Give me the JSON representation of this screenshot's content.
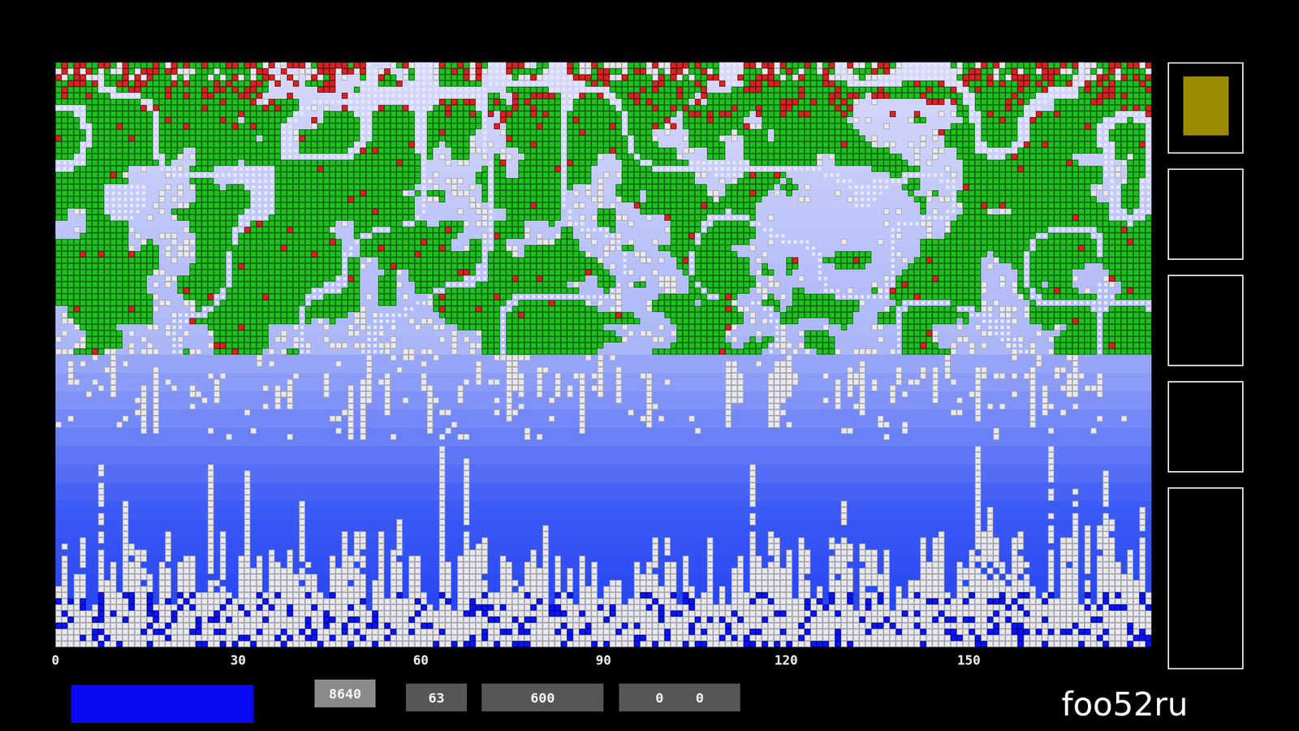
{
  "world": {
    "x_axis": {
      "ticks": [
        "0",
        "30",
        "60",
        "90",
        "120",
        "150"
      ]
    }
  },
  "side_panels": [
    {
      "filled": true,
      "color": "#9c8a00"
    },
    {
      "filled": false,
      "color": "#000000"
    },
    {
      "filled": false,
      "color": "#000000"
    },
    {
      "filled": false,
      "color": "#000000"
    },
    {
      "filled": false,
      "color": "#000000"
    }
  ],
  "status_bar": {
    "mode_indicator": {
      "color": "#0a0af2"
    },
    "counters": [
      {
        "values": [
          "8640"
        ],
        "highlighted": true
      },
      {
        "values": [
          "63"
        ],
        "highlighted": false
      },
      {
        "values": [
          "600"
        ],
        "highlighted": false
      },
      {
        "values": [
          "0",
          "0"
        ],
        "highlighted": false
      }
    ]
  },
  "logo": "foo52ru"
}
